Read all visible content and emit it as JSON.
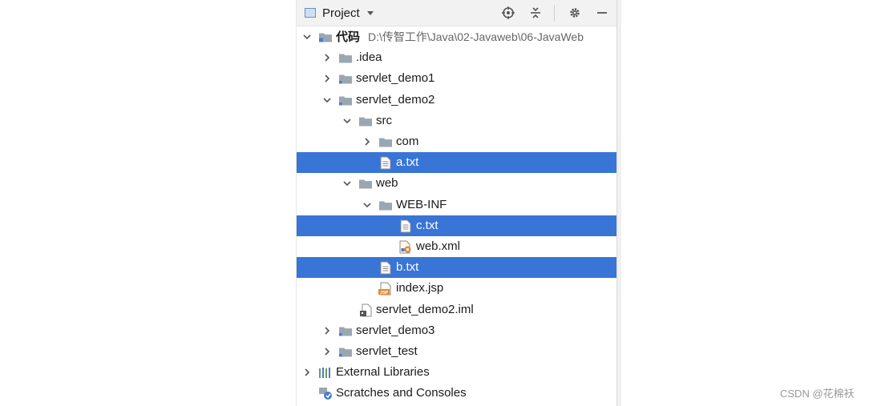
{
  "header": {
    "title": "Project",
    "tools": [
      "locate-icon",
      "collapse-icon",
      "gear-icon",
      "minimize-icon"
    ]
  },
  "tree": [
    {
      "name": "代码",
      "path": "D:\\传智工作\\Java\\02-Javaweb\\06-JavaWeb",
      "type": "module",
      "level": 0,
      "expanded": true,
      "bold": true
    },
    {
      "name": ".idea",
      "type": "folder",
      "level": 1,
      "expanded": false
    },
    {
      "name": "servlet_demo1",
      "type": "module-folder",
      "level": 1,
      "expanded": false
    },
    {
      "name": "servlet_demo2",
      "type": "module-folder",
      "level": 1,
      "expanded": true
    },
    {
      "name": "src",
      "type": "folder",
      "level": 2,
      "expanded": true
    },
    {
      "name": "com",
      "type": "folder",
      "level": 3,
      "expanded": false
    },
    {
      "name": "a.txt",
      "type": "txt",
      "level": 3,
      "selected": true
    },
    {
      "name": "web",
      "type": "folder",
      "level": 2,
      "expanded": true
    },
    {
      "name": "WEB-INF",
      "type": "folder",
      "level": 3,
      "expanded": true
    },
    {
      "name": "c.txt",
      "type": "txt",
      "level": 4,
      "selected": true
    },
    {
      "name": "web.xml",
      "type": "xml",
      "level": 4
    },
    {
      "name": "b.txt",
      "type": "txt",
      "level": 3,
      "selected": true
    },
    {
      "name": "index.jsp",
      "type": "jsp",
      "level": 3
    },
    {
      "name": "servlet_demo2.iml",
      "type": "iml",
      "level": 2
    },
    {
      "name": "servlet_demo3",
      "type": "module-folder",
      "level": 1,
      "expanded": false
    },
    {
      "name": "servlet_test",
      "type": "module-folder",
      "level": 1,
      "expanded": false
    },
    {
      "name": "External Libraries",
      "type": "libraries",
      "level": 0,
      "expanded": false
    },
    {
      "name": "Scratches and Consoles",
      "type": "scratches",
      "level": 0
    }
  ],
  "watermark": "CSDN @花棉袄",
  "colors": {
    "selection": "#3875d7",
    "folder": "#9aa7b0",
    "jsp": "#e8882a"
  }
}
